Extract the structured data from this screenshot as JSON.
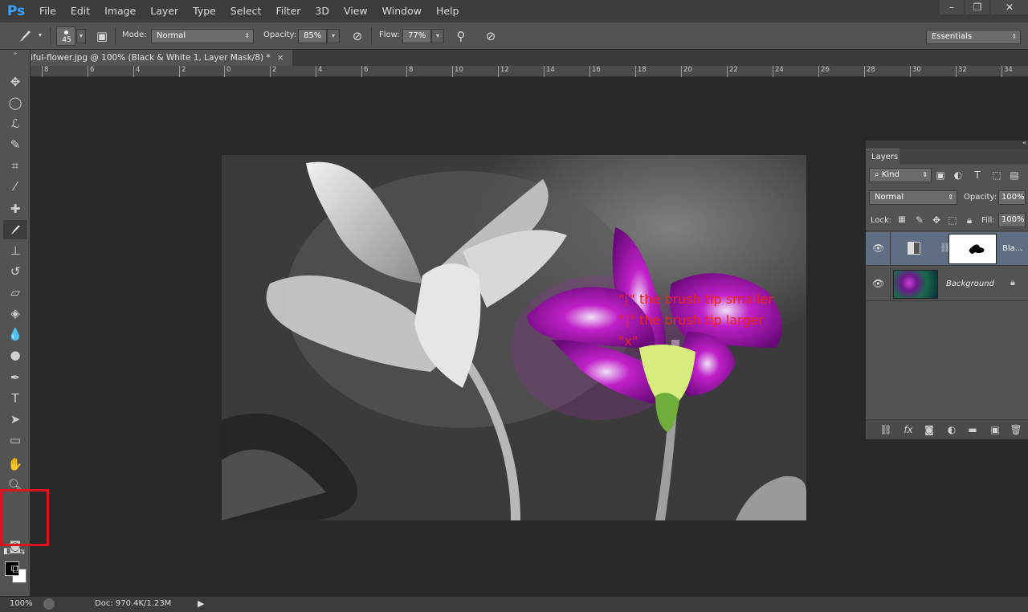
{
  "app": {
    "logo": "Ps"
  },
  "menu": [
    "File",
    "Edit",
    "Image",
    "Layer",
    "Type",
    "Select",
    "Filter",
    "3D",
    "View",
    "Window",
    "Help"
  ],
  "window_controls": {
    "minimize": "–",
    "restore": "❐",
    "close": "✕"
  },
  "options": {
    "brush_size": "45",
    "mode_label": "Mode:",
    "mode_value": "Normal",
    "opacity_label": "Opacity:",
    "opacity_value": "85%",
    "flow_label": "Flow:",
    "flow_value": "77%",
    "workspace": "Essentials"
  },
  "document_tab": {
    "title": "iful-flower.jpg @ 100% (Black & White 1, Layer Mask/8) *",
    "close": "×"
  },
  "ruler_ticks": [
    "8",
    "6",
    "4",
    "2",
    "0",
    "2",
    "4",
    "6",
    "8",
    "10",
    "12",
    "14",
    "16",
    "18",
    "20",
    "22",
    "24",
    "26",
    "28",
    "30",
    "32",
    "34"
  ],
  "canvas_annotations": {
    "line1": "\"[\"  the brush tip smaller",
    "line2": "\"]\"   the brush tip larger",
    "line3": "\"x\""
  },
  "layers_panel": {
    "tab": "Layers",
    "filter_kind": "Kind",
    "blend_mode": "Normal",
    "opacity_label": "Opacity:",
    "opacity_value": "100%",
    "lock_label": "Lock:",
    "fill_label": "Fill:",
    "fill_value": "100%",
    "layers": [
      {
        "name": "Bla...",
        "selected": true
      },
      {
        "name": "Background",
        "selected": false
      }
    ]
  },
  "status": {
    "zoom": "100%",
    "doc_info": "Doc: 970.4K/1.23M"
  },
  "colors": {
    "accent_highlight": "#e0131c",
    "annotation_text": "#e5261f",
    "ps_blue": "#3aa0ff"
  }
}
